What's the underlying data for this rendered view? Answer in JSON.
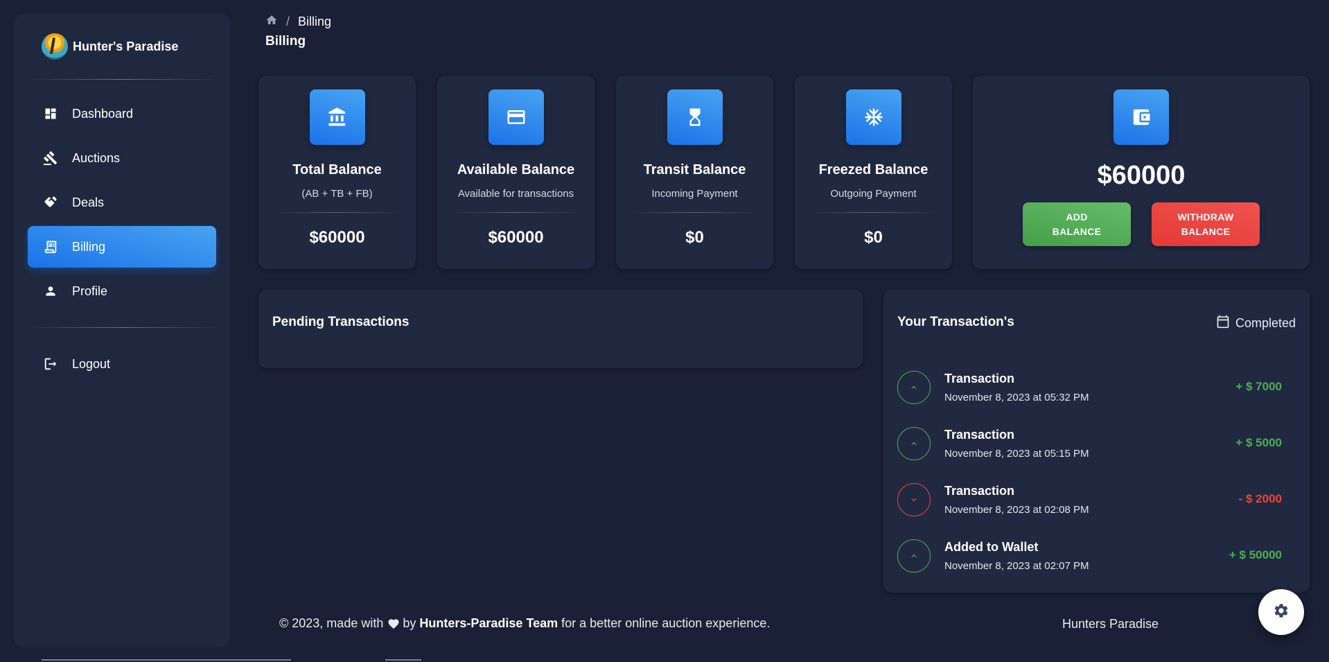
{
  "brand": {
    "name": "Hunter's Paradise"
  },
  "sidebar": {
    "items": [
      {
        "label": "Dashboard",
        "icon": "dashboard-icon",
        "active": false
      },
      {
        "label": "Auctions",
        "icon": "gavel-icon",
        "active": false
      },
      {
        "label": "Deals",
        "icon": "handshake-icon",
        "active": false
      },
      {
        "label": "Billing",
        "icon": "receipt-icon",
        "active": true
      },
      {
        "label": "Profile",
        "icon": "person-icon",
        "active": false
      }
    ],
    "logout": {
      "label": "Logout",
      "icon": "logout-icon"
    }
  },
  "header": {
    "breadcrumb": {
      "home_icon": "home-icon",
      "separator": "/",
      "current": "Billing"
    },
    "title": "Billing"
  },
  "stats": [
    {
      "title": "Total Balance",
      "subtitle": "(AB + TB + FB)",
      "value": "$60000",
      "icon": "bank-icon"
    },
    {
      "title": "Available Balance",
      "subtitle": "Available for transactions",
      "value": "$60000",
      "icon": "card-icon"
    },
    {
      "title": "Transit Balance",
      "subtitle": "Incoming Payment",
      "value": "$0",
      "icon": "hourglass-icon"
    },
    {
      "title": "Freezed Balance",
      "subtitle": "Outgoing Payment",
      "value": "$0",
      "icon": "snowflake-icon"
    }
  ],
  "wallet": {
    "icon": "wallet-icon",
    "amount": "$60000",
    "add_line1": "ADD",
    "add_line2": "BALANCE",
    "withdraw_line1": "WITHDRAW",
    "withdraw_line2": "BALANCE"
  },
  "pending": {
    "title": "Pending Transactions"
  },
  "transactions": {
    "title": "Your Transaction's",
    "filter_label": "Completed",
    "items": [
      {
        "name": "Transaction",
        "date": "November 8, 2023 at 05:32 PM",
        "amount": "+ $ 7000",
        "direction": "up"
      },
      {
        "name": "Transaction",
        "date": "November 8, 2023 at 05:15 PM",
        "amount": "+ $ 5000",
        "direction": "up"
      },
      {
        "name": "Transaction",
        "date": "November 8, 2023 at 02:08 PM",
        "amount": "- $ 2000",
        "direction": "down"
      },
      {
        "name": "Added to Wallet",
        "date": "November 8, 2023 at 02:07 PM",
        "amount": "+ $ 50000",
        "direction": "up"
      }
    ]
  },
  "footer": {
    "prefix": "© 2023, made with",
    "by": "by",
    "team": "Hunters-Paradise Team",
    "suffix": "for a better online auction experience.",
    "right": "Hunters Paradise"
  },
  "colors": {
    "background": "#1a2035",
    "card": "#202940",
    "accent": "#1A73E8",
    "success": "#4caf50",
    "danger": "#f44335"
  }
}
